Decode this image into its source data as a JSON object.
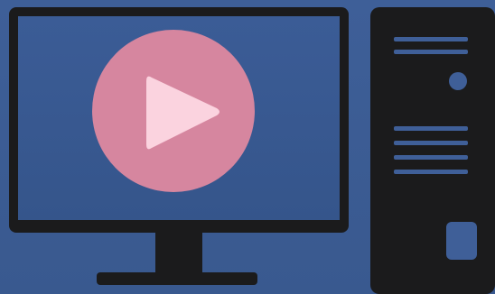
{
  "illustration": {
    "subject": "desktop-computer",
    "icons": {
      "monitor": "monitor-icon",
      "play": "play-icon",
      "tower": "computer-tower-icon"
    },
    "colors": {
      "background": "#3e5f98",
      "device_body": "#1b1b1c",
      "screen": "#3a5a93",
      "play_circle": "#d6869f",
      "play_triangle": "#fbd3df",
      "tower_accent": "#3f5f98"
    }
  }
}
